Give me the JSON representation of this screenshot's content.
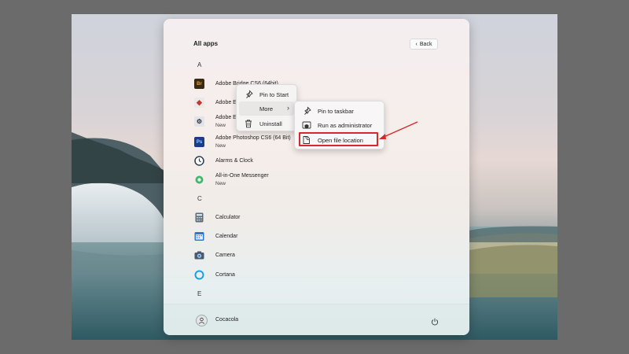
{
  "start_menu": {
    "title": "All apps",
    "back_label": "Back",
    "sections": [
      {
        "letter": "A",
        "apps": [
          {
            "name": "Adobe Bridge CS6 (64bit)",
            "sub": "",
            "icon": "bridge-icon",
            "color": "#3a2a10",
            "glyph": "Br"
          },
          {
            "name": "Adobe E",
            "sub": "",
            "icon": "adobe-extension-icon",
            "color": "#d04a3a",
            "glyph": "◆"
          },
          {
            "name": "Adobe E",
            "sub": "New",
            "icon": "adobe-exchange-icon",
            "color": "#e0e4ea",
            "glyph": "⚙"
          },
          {
            "name": "Adobe Photoshop CS6 (64 Bit)",
            "sub": "New",
            "icon": "photoshop-icon",
            "color": "#1b3b8f",
            "glyph": "Ps"
          },
          {
            "name": "Alarms & Clock",
            "sub": "",
            "icon": "clock-icon",
            "color": "#ffffff",
            "glyph": ""
          },
          {
            "name": "All-in-One Messenger",
            "sub": "New",
            "icon": "messenger-icon",
            "color": "#3fb86b",
            "glyph": ""
          }
        ]
      },
      {
        "letter": "C",
        "apps": [
          {
            "name": "Calculator",
            "sub": "",
            "icon": "calculator-icon",
            "color": "#5a6b7c",
            "glyph": ""
          },
          {
            "name": "Calendar",
            "sub": "",
            "icon": "calendar-icon",
            "color": "#2b79d4",
            "glyph": ""
          },
          {
            "name": "Camera",
            "sub": "",
            "icon": "camera-icon",
            "color": "#4a5a6a",
            "glyph": ""
          },
          {
            "name": "Cortana",
            "sub": "",
            "icon": "cortana-icon",
            "color": "#1aa0e0",
            "glyph": ""
          }
        ]
      },
      {
        "letter": "E",
        "apps": []
      }
    ],
    "user_name": "Cocacola"
  },
  "context_menu": {
    "items": [
      {
        "label": "Pin to Start",
        "icon": "pin-icon"
      },
      {
        "label": "More",
        "icon": "",
        "has_submenu": true
      },
      {
        "label": "Uninstall",
        "icon": "trash-icon"
      }
    ]
  },
  "submenu": {
    "items": [
      {
        "label": "Pin to taskbar",
        "icon": "pin-icon"
      },
      {
        "label": "Run as administrator",
        "icon": "shield-icon"
      },
      {
        "label": "Open file location",
        "icon": "folder-icon",
        "highlighted": true
      }
    ]
  },
  "colors": {
    "highlight": "#d42a2a",
    "arrow": "#d42a2a"
  }
}
